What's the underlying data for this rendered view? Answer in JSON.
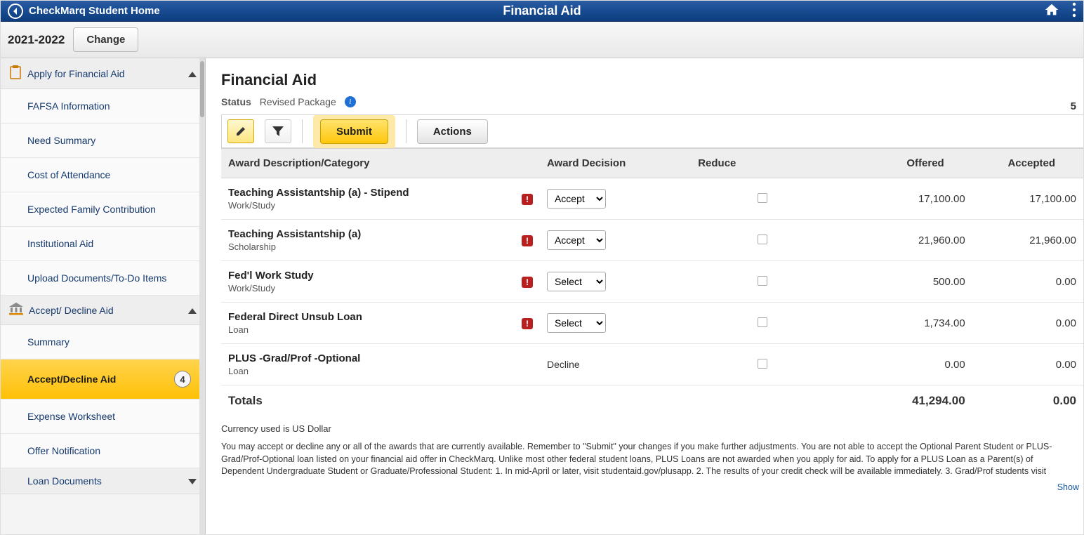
{
  "header": {
    "breadcrumb": "CheckMarq Student Home",
    "title": "Financial Aid"
  },
  "subheader": {
    "year": "2021-2022",
    "change_label": "Change"
  },
  "sidebar": {
    "groups": [
      {
        "id": "apply",
        "label": "Apply for Financial Aid",
        "icon": "clipboard-icon",
        "expanded": true,
        "items": [
          {
            "id": "fafsa",
            "label": "FAFSA Information"
          },
          {
            "id": "need",
            "label": "Need Summary"
          },
          {
            "id": "coa",
            "label": "Cost of Attendance"
          },
          {
            "id": "efc",
            "label": "Expected Family Contribution"
          },
          {
            "id": "inst",
            "label": "Institutional Aid"
          },
          {
            "id": "upload",
            "label": "Upload Documents/To-Do Items"
          }
        ]
      },
      {
        "id": "accept",
        "label": "Accept/ Decline Aid",
        "icon": "bank-icon",
        "expanded": true,
        "items": [
          {
            "id": "summary",
            "label": "Summary"
          },
          {
            "id": "acd",
            "label": "Accept/Decline Aid",
            "active": true,
            "badge": "4"
          },
          {
            "id": "expense",
            "label": "Expense Worksheet"
          },
          {
            "id": "offer",
            "label": "Offer Notification"
          }
        ]
      },
      {
        "id": "loans",
        "label": "Loan Documents",
        "icon": "document-icon",
        "expanded": false,
        "items": []
      }
    ]
  },
  "main": {
    "heading": "Financial Aid",
    "status_label": "Status",
    "status_value": "Revised Package",
    "row_count": "5",
    "toolbar": {
      "submit_label": "Submit",
      "actions_label": "Actions"
    },
    "columns": {
      "desc": "Award Description/Category",
      "decision": "Award Decision",
      "reduce": "Reduce",
      "offered": "Offered",
      "accepted": "Accepted"
    },
    "rows": [
      {
        "title": "Teaching Assistantship (a) - Stipend",
        "category": "Work/Study",
        "alert": true,
        "decision_select": "Accept",
        "reduce": false,
        "offered": "17,100.00",
        "accepted": "17,100.00"
      },
      {
        "title": "Teaching Assistantship (a)",
        "category": "Scholarship",
        "alert": true,
        "decision_select": "Accept",
        "reduce": false,
        "offered": "21,960.00",
        "accepted": "21,960.00"
      },
      {
        "title": "Fed'l Work Study",
        "category": "Work/Study",
        "alert": true,
        "decision_select": "Select",
        "reduce": false,
        "offered": "500.00",
        "accepted": "0.00"
      },
      {
        "title": "Federal Direct Unsub Loan",
        "category": "Loan",
        "alert": true,
        "decision_select": "Select",
        "reduce": false,
        "offered": "1,734.00",
        "accepted": "0.00"
      },
      {
        "title": "PLUS -Grad/Prof -Optional",
        "category": "Loan",
        "alert": false,
        "decision_text": "Decline",
        "reduce": false,
        "offered": "0.00",
        "accepted": "0.00"
      }
    ],
    "totals": {
      "label": "Totals",
      "offered": "41,294.00",
      "accepted": "0.00"
    },
    "currency_note": "Currency used is US Dollar",
    "disclaimer": "You may accept or decline any or all of the awards that are currently available. Remember to \"Submit\" your changes if you make further adjustments. You are not able to accept the Optional Parent Student or PLUS-Grad/Prof-Optional loan listed on your financial aid offer in CheckMarq. Unlike most other federal student loans, PLUS Loans are not awarded when you apply for aid. To apply for a PLUS Loan as a Parent(s) of Dependent Undergraduate Student or Graduate/Professional Student: 1. In mid-April or later, visit studentaid.gov/plusapp. 2. The results of your credit check will be available immediately. 3. Grad/Prof students visit",
    "show_more": "Show"
  }
}
